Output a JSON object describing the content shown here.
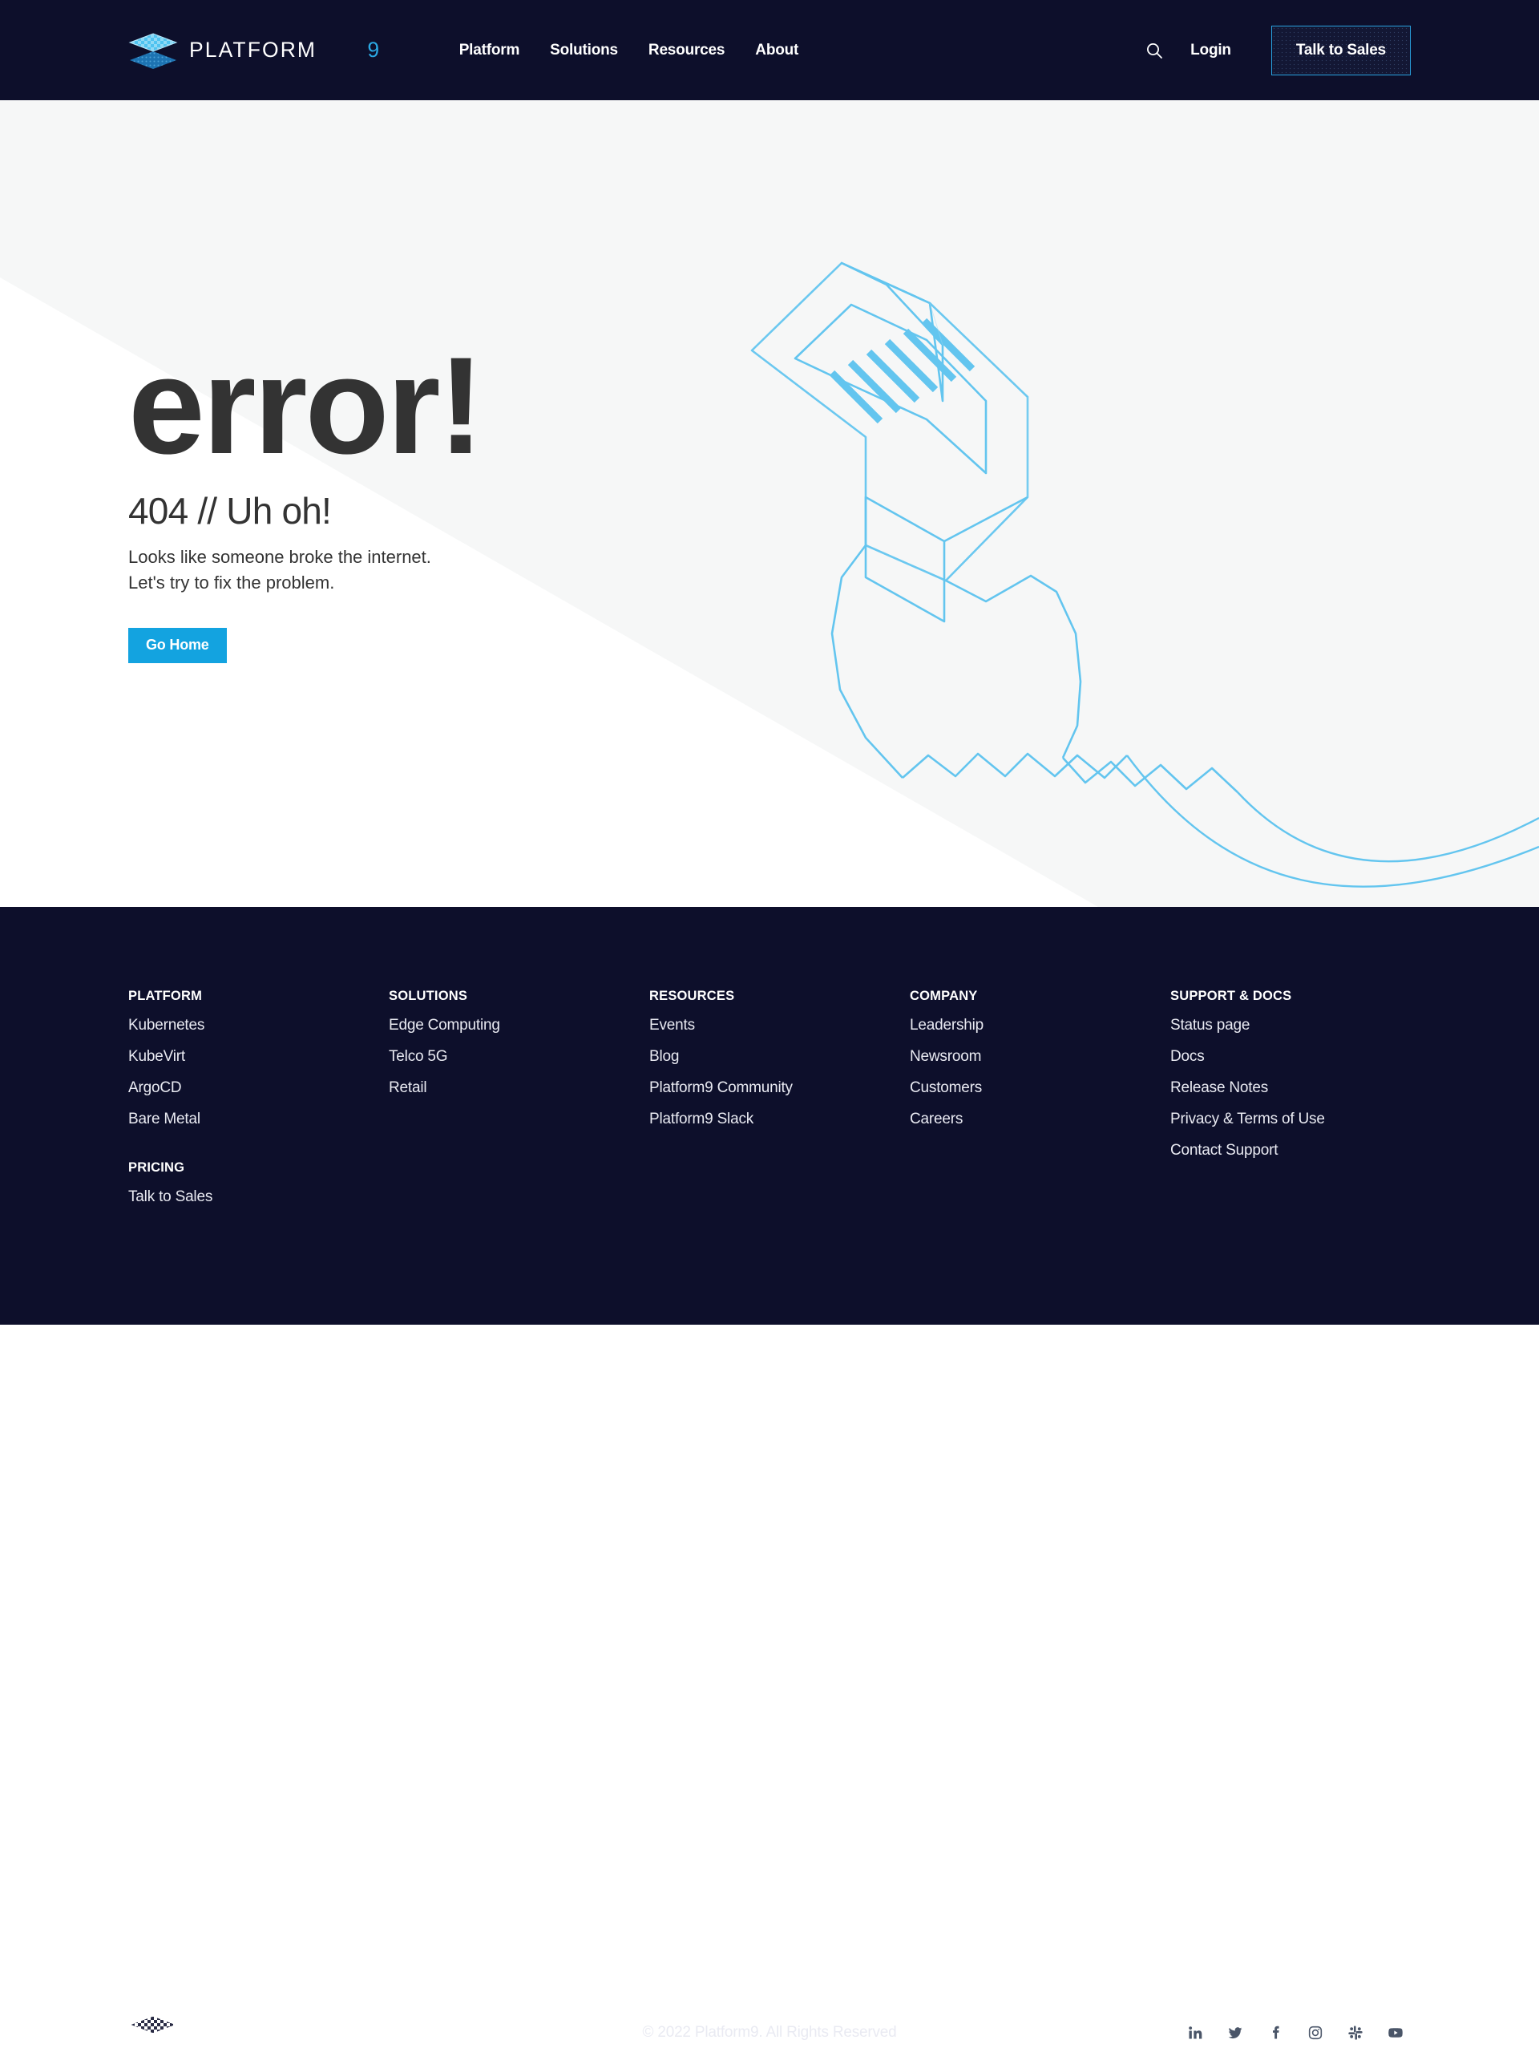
{
  "header": {
    "logo_text": "PLATFORM9",
    "nav": [
      {
        "label": "Platform"
      },
      {
        "label": "Solutions"
      },
      {
        "label": "Resources"
      },
      {
        "label": "About"
      }
    ],
    "search_label": "Search",
    "login_label": "Login",
    "cta_label": "Talk to Sales"
  },
  "hero": {
    "title": "error!",
    "subtitle": "404 // Uh oh!",
    "body_line1": "Looks like someone broke the internet.",
    "body_line2": "Let's try to fix the problem.",
    "button_label": "Go Home",
    "illustration": "ethernet-cable-rj45"
  },
  "footer": {
    "columns": [
      {
        "heading": "PLATFORM",
        "links": [
          "Kubernetes",
          "KubeVirt",
          "ArgoCD",
          "Bare Metal"
        ],
        "heading2": "PRICING",
        "links2": [
          "Talk to Sales"
        ]
      },
      {
        "heading": "SOLUTIONS",
        "links": [
          "Edge Computing",
          "Telco 5G",
          "Retail"
        ]
      },
      {
        "heading": "RESOURCES",
        "links": [
          "Events",
          "Blog",
          "Platform9 Community",
          "Platform9 Slack"
        ]
      },
      {
        "heading": "COMPANY",
        "links": [
          "Leadership",
          "Newsroom",
          "Customers",
          "Careers"
        ]
      },
      {
        "heading": "SUPPORT & DOCS",
        "links": [
          "Status page",
          "Docs",
          "Release Notes",
          "Privacy & Terms of Use",
          "Contact Support"
        ]
      }
    ],
    "logo_text": "PLATFORM9",
    "copyright": "© 2022 Platform9. All Rights Reserved",
    "socials": [
      {
        "name": "linkedin"
      },
      {
        "name": "twitter"
      },
      {
        "name": "facebook"
      },
      {
        "name": "instagram"
      },
      {
        "name": "slack"
      },
      {
        "name": "youtube"
      }
    ]
  },
  "colors": {
    "header_bg": "#0d0f2b",
    "footer_bg": "#0d0f2b",
    "hero_bg": "#f6f7f7",
    "accent_blue": "#13a3e0",
    "cta_border": "#29a3e0",
    "cable_line": "#63c5ef",
    "heading_text": "#333333"
  }
}
